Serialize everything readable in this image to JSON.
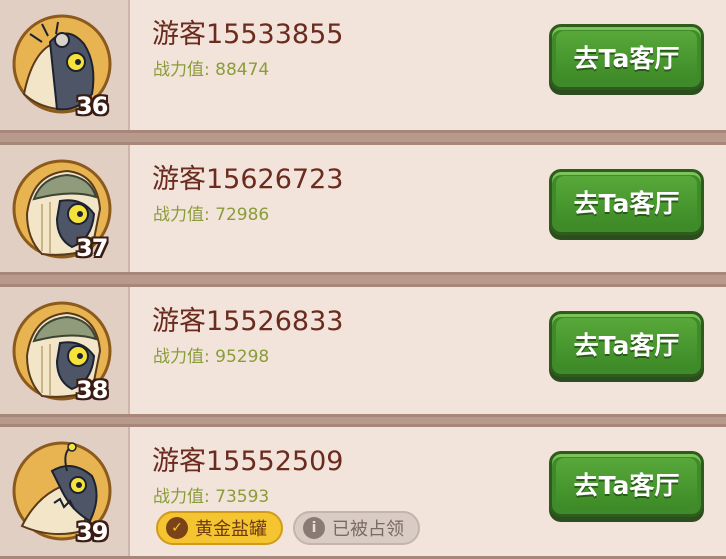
{
  "players": [
    {
      "name": "游客15533855",
      "power_label": "战力值:",
      "power": "88474",
      "level": "36",
      "button": "去Ta客厅",
      "avatar": "rat-avatar-icon"
    },
    {
      "name": "游客15626723",
      "power_label": "战力值:",
      "power": "72986",
      "level": "37",
      "button": "去Ta客厅",
      "avatar": "helmet-creature-avatar-icon"
    },
    {
      "name": "游客15526833",
      "power_label": "战力值:",
      "power": "95298",
      "level": "38",
      "button": "去Ta客厅",
      "avatar": "helmet-creature-avatar-icon"
    },
    {
      "name": "游客15552509",
      "power_label": "战力值:",
      "power": "73593",
      "level": "39",
      "button": "去Ta客厅",
      "avatar": "anglerfish-avatar-icon",
      "badges": [
        {
          "label": "黄金盐罐",
          "icon": "check-icon",
          "color": "#f4c531"
        },
        {
          "label": "已被占领",
          "icon": "info-icon",
          "color": "#d9ccc5"
        }
      ]
    }
  ],
  "colors": {
    "button_green": "#3f8a2a",
    "name": "#6b2b1f",
    "power": "#8a9c3a",
    "row_bg": "#f2e4da"
  }
}
